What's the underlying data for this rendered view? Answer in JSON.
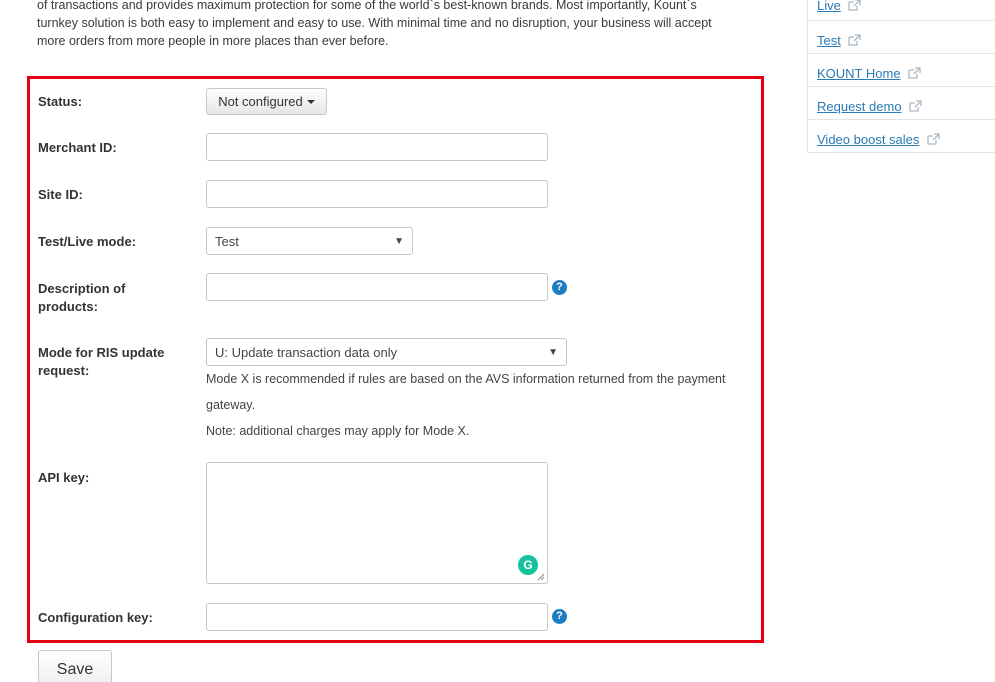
{
  "intro": {
    "line1": "of transactions and provides maximum protection for some of the world`s best-known brands. Most importantly, Kount`s",
    "line2": "turnkey solution is both easy to implement and easy to use. With minimal time and no disruption, your business will accept",
    "line3": "more orders from more people in more places than ever before."
  },
  "sidebar": {
    "items": [
      {
        "label": "Live"
      },
      {
        "label": "Test"
      },
      {
        "label": "KOUNT Home"
      },
      {
        "label": "Request demo"
      },
      {
        "label": "Video boost sales"
      }
    ],
    "icon": "external-link-icon"
  },
  "form": {
    "status": {
      "label": "Status:",
      "value": "Not configured"
    },
    "merchant_id": {
      "label": "Merchant ID:",
      "value": ""
    },
    "site_id": {
      "label": "Site ID:",
      "value": ""
    },
    "mode": {
      "label": "Test/Live mode:",
      "value": "Test"
    },
    "description": {
      "label_line1": "Description of",
      "label_line2": "products:",
      "value": "",
      "help_icon": "question-circle-icon"
    },
    "ris_mode": {
      "label_line1": "Mode for RIS update",
      "label_line2": "request:",
      "value": "U: Update transaction data only",
      "note_line1": "Mode X is recommended if rules are based on the AVS information returned from the payment",
      "note_line2": "gateway.",
      "note_line3": "Note: additional charges may apply for Mode X."
    },
    "api_key": {
      "label": "API key:",
      "value": "",
      "grammarly_icon": "grammarly-icon"
    },
    "config_key": {
      "label": "Configuration key:",
      "value": "",
      "help_icon": "question-circle-icon"
    },
    "save_label": "Save"
  },
  "colors": {
    "highlight_border": "#e60012",
    "link": "#2a7ab5",
    "help_icon": "#1e7cc0",
    "grammarly": "#15c39a"
  }
}
